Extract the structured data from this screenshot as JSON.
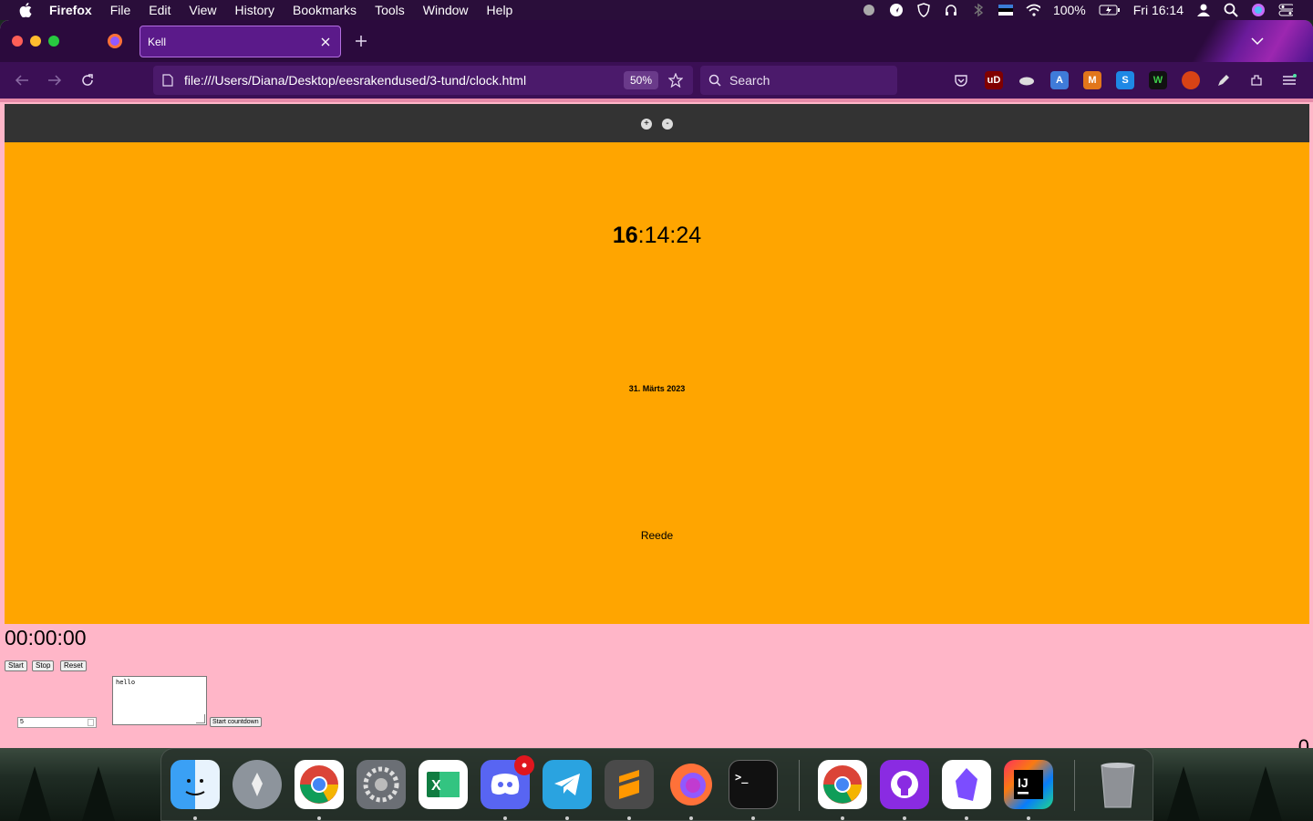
{
  "menubar": {
    "app_name": "Firefox",
    "items": [
      "File",
      "Edit",
      "View",
      "History",
      "Bookmarks",
      "Tools",
      "Window",
      "Help"
    ],
    "battery": "100%",
    "clock": "Fri 16:14"
  },
  "browser": {
    "tab_title": "Kell",
    "url": "file:///Users/Diana/Desktop/eesrakendused/3-tund/clock.html",
    "zoom": "50%",
    "search_placeholder": "Search"
  },
  "page": {
    "zoom_in_label": "+",
    "zoom_out_label": "-",
    "time_hours": "16",
    "time_rest": ":14:24",
    "date": "31. Märts 2023",
    "weekday": "Reede",
    "stopwatch": "00:00:00",
    "start_label": "Start",
    "stop_label": "Stop",
    "reset_label": "Reset",
    "number_value": "5",
    "textarea_value": "hello",
    "countdown_label": "Start countdown",
    "counter": "0"
  },
  "dock": {
    "apps": [
      "finder",
      "launchpad",
      "chrome",
      "system-preferences",
      "excel",
      "discord",
      "telegram",
      "sublime-text",
      "firefox",
      "terminal",
      "chrome",
      "github-desktop",
      "obsidian",
      "intellij",
      "trash"
    ]
  },
  "colors": {
    "page_background": "#ffb6c8",
    "clock_background": "#ffa500",
    "browser_chrome": "#2b0a3d"
  }
}
